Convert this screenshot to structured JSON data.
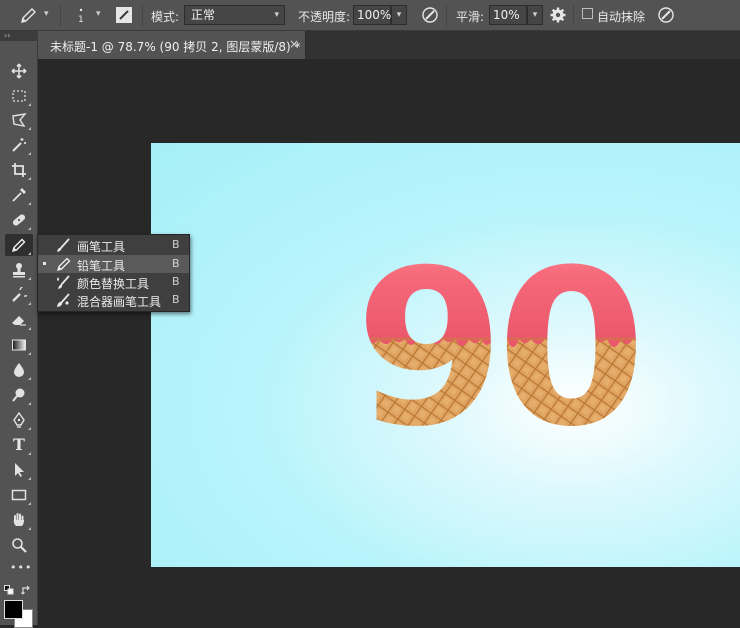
{
  "options_bar": {
    "brush_size": "1",
    "mode_label": "模式:",
    "mode_value": "正常",
    "opacity_label": "不透明度:",
    "opacity_value": "100%",
    "smoothing_label": "平滑:",
    "smoothing_value": "10%",
    "auto_erase_label": "自动抹除",
    "auto_erase_checked": false
  },
  "document_tab": {
    "title": "未标题-1 @ 78.7% (90 拷贝 2, 图层蒙版/8) *",
    "close": "×"
  },
  "toolbox": {
    "collapse_glyph": "››",
    "tools": [
      "move-icon",
      "marquee-icon",
      "lasso-icon",
      "magic-wand-icon",
      "crop-icon",
      "eyedropper-icon",
      "healing-brush-icon",
      "pencil-icon",
      "clone-stamp-icon",
      "history-brush-icon",
      "eraser-icon",
      "gradient-icon",
      "blur-icon",
      "dodge-icon",
      "pen-icon",
      "type-icon",
      "path-selection-icon",
      "rectangle-icon",
      "hand-icon",
      "zoom-icon",
      "more-tools-icon"
    ],
    "type_glyph": "T",
    "more_glyph": "•••",
    "foreground_color": "#000000",
    "background_color": "#ffffff"
  },
  "flyout": {
    "items": [
      {
        "label": "画笔工具",
        "shortcut": "B"
      },
      {
        "label": "铅笔工具",
        "shortcut": "B"
      },
      {
        "label": "颜色替换工具",
        "shortcut": "B"
      },
      {
        "label": "混合器画笔工具",
        "shortcut": "B"
      }
    ],
    "active_index": 1
  },
  "canvas": {
    "text": "90",
    "icing_color": "#f6697a",
    "cone_color": "#dd9a57",
    "background_color": "#b3f2fa"
  }
}
